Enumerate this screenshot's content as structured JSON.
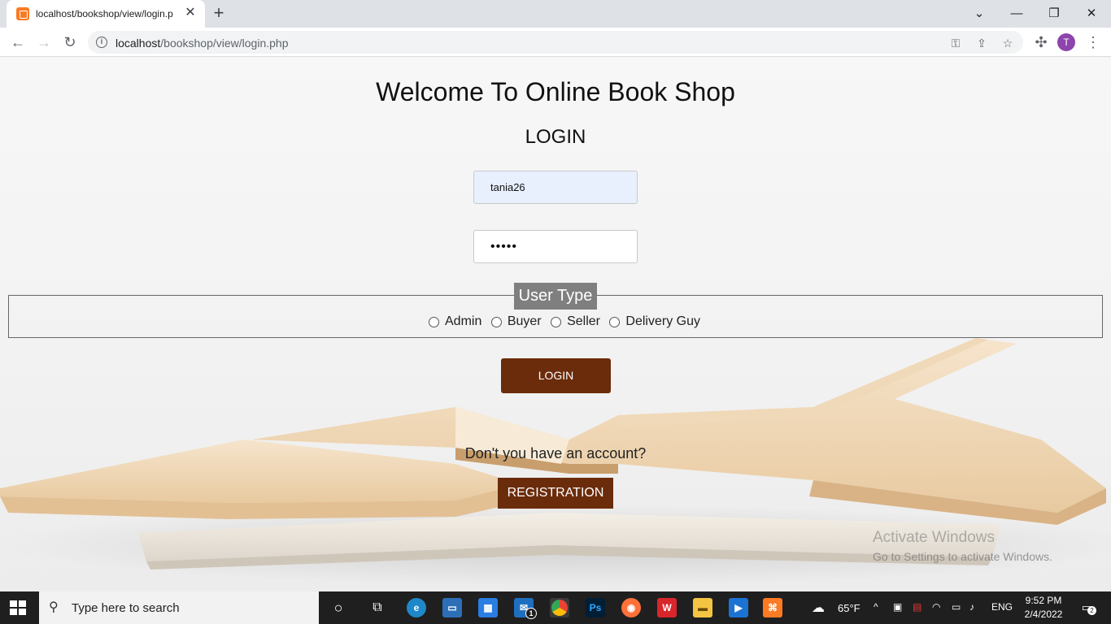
{
  "browser": {
    "tab_title": "localhost/bookshop/view/login.p",
    "url_host": "localhost",
    "url_path": "/bookshop/view/login.php",
    "profile_initial": "T"
  },
  "page": {
    "title": "Welcome To Online Book Shop",
    "subtitle": "LOGIN",
    "username_value": "tania26",
    "password_mask": "•••••",
    "user_type_legend": "User Type",
    "user_types": [
      "Admin",
      "Buyer",
      "Seller",
      "Delivery Guy"
    ],
    "login_button": "LOGIN",
    "no_account_text": "Don't you have an account?",
    "registration_button": "REGISTRATION"
  },
  "watermark": {
    "line1": "Activate Windows",
    "line2": "Go to Settings to activate Windows."
  },
  "taskbar": {
    "search_placeholder": "Type here to search",
    "weather": "65°F",
    "language": "ENG",
    "time": "9:52 PM",
    "date": "2/4/2022",
    "notification_count": "2",
    "mail_badge": "1"
  },
  "colors": {
    "button_brown": "#6b2c0c",
    "legend_gray": "#7f7f7f",
    "autofill_blue": "#e8f0fe"
  }
}
